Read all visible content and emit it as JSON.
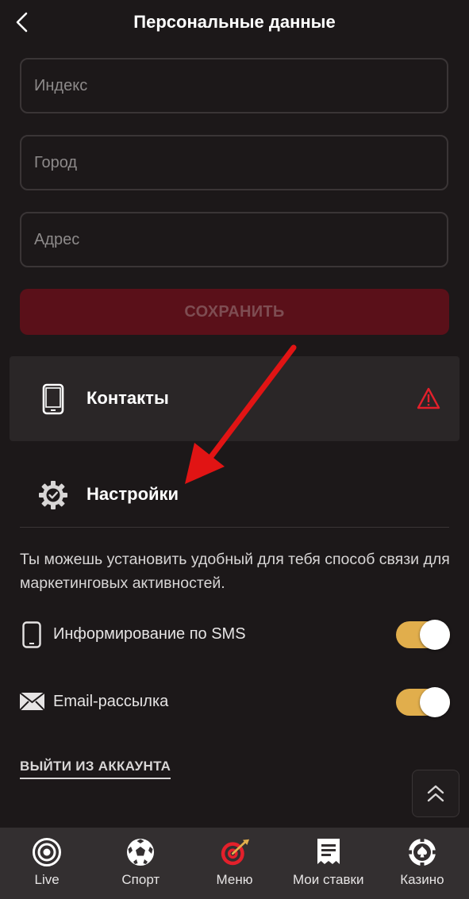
{
  "header": {
    "title": "Персональные данные"
  },
  "form": {
    "index_placeholder": "Индекс",
    "city_placeholder": "Город",
    "address_placeholder": "Адрес",
    "save_label": "СОХРАНИТЬ"
  },
  "sections": {
    "contacts_label": "Контакты",
    "settings_label": "Настройки"
  },
  "settings": {
    "description": "Ты можешь установить удобный для тебя способ связи для маркетинговых активностей.",
    "sms_label": "Информирование по SMS",
    "sms_enabled": true,
    "email_label": "Email-рассылка",
    "email_enabled": true
  },
  "logout_label": "ВЫЙТИ ИЗ АККАУНТА",
  "nav": {
    "items": [
      {
        "label": "Live",
        "icon": "live-icon"
      },
      {
        "label": "Спорт",
        "icon": "soccer-ball-icon"
      },
      {
        "label": "Меню",
        "icon": "target-icon"
      },
      {
        "label": "Мои ставки",
        "icon": "receipt-icon"
      },
      {
        "label": "Казино",
        "icon": "casino-chip-icon"
      }
    ]
  },
  "colors": {
    "background": "#1c1819",
    "accent_red": "#e3202b",
    "toggle_on": "#e1ae4c",
    "nav_bg": "#332f30"
  }
}
